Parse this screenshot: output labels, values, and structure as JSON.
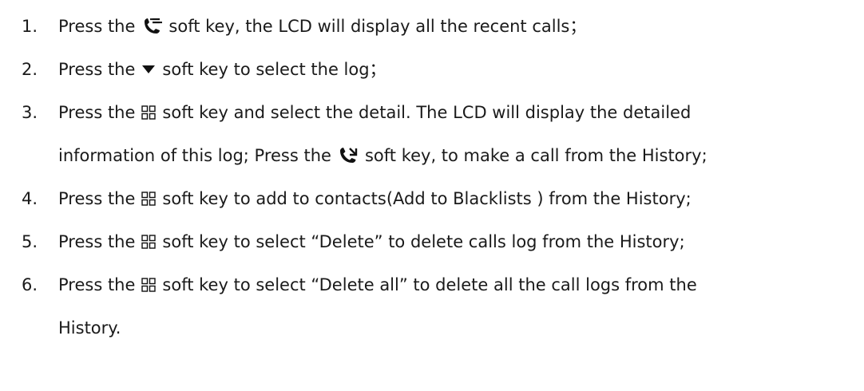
{
  "steps": [
    {
      "number": "1.",
      "before": "Press the",
      "icon": "history-phone-icon",
      "after": "soft key, the LCD will display all the recent calls；"
    },
    {
      "number": "2.",
      "before": "Press the",
      "icon": "down-arrow-icon",
      "after": "soft key to select the log；"
    },
    {
      "number": "3.",
      "before": "Press the",
      "icon": "menu-grid-icon",
      "after": "soft key and select the detail. The LCD will display the detailed",
      "continuation_before": "information of this log; Press the",
      "continuation_icon": "call-phone-icon",
      "continuation_after": "soft key, to make a call from the History;"
    },
    {
      "number": "4.",
      "before": "Press the",
      "icon": "menu-grid-icon",
      "after": "soft key to add to contacts(Add to Blacklists ) from the History;"
    },
    {
      "number": "5.",
      "before": "Press the",
      "icon": "menu-grid-icon",
      "after": "soft key to select “Delete” to delete calls log from the History;"
    },
    {
      "number": "6.",
      "before": "Press the",
      "icon": "menu-grid-icon",
      "after": "soft key to select “Delete all” to delete all the call logs from the",
      "continuation_text": "History."
    }
  ]
}
